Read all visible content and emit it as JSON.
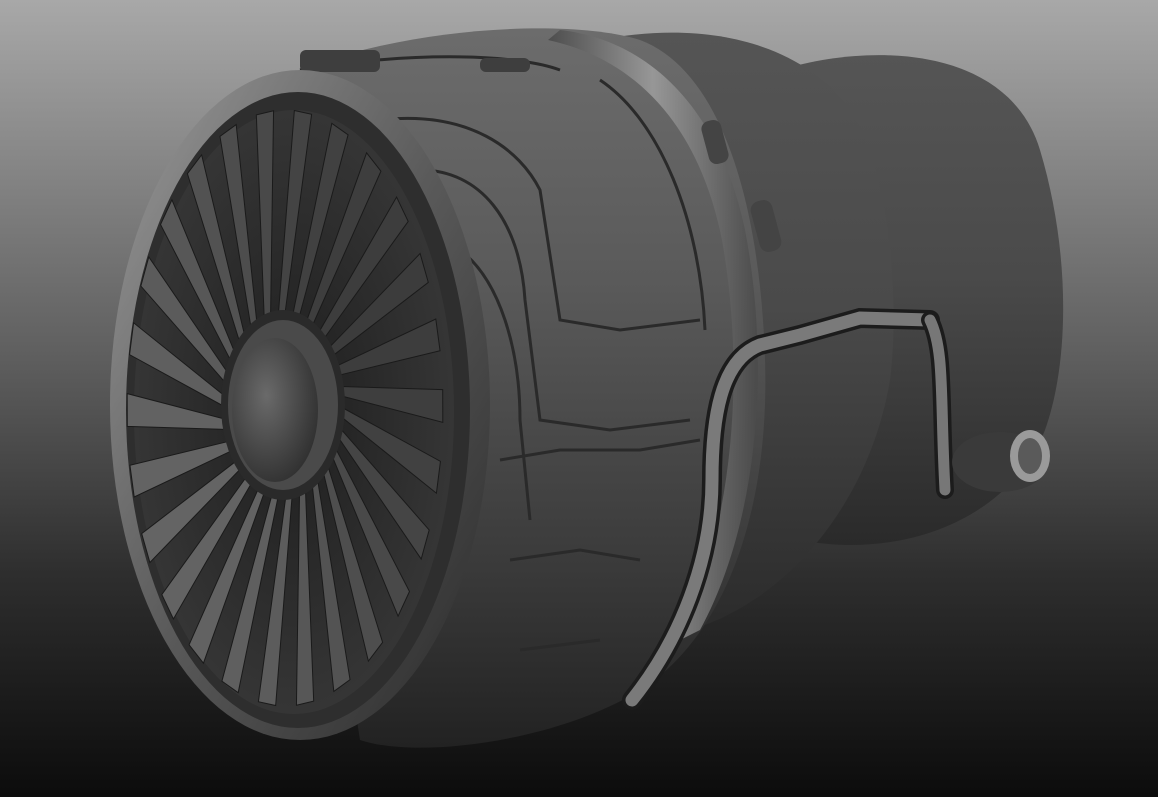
{
  "scene": {
    "subject": "jet-engine-model",
    "render_style": "grayscale-viewport",
    "colors": {
      "background_top": "#a8a8a8",
      "background_bottom": "#0c0c0c",
      "body_dark": "#3a3a3a",
      "body_mid": "#555555",
      "body_light": "#7a7a7a",
      "highlight": "#cfcfcf"
    }
  }
}
